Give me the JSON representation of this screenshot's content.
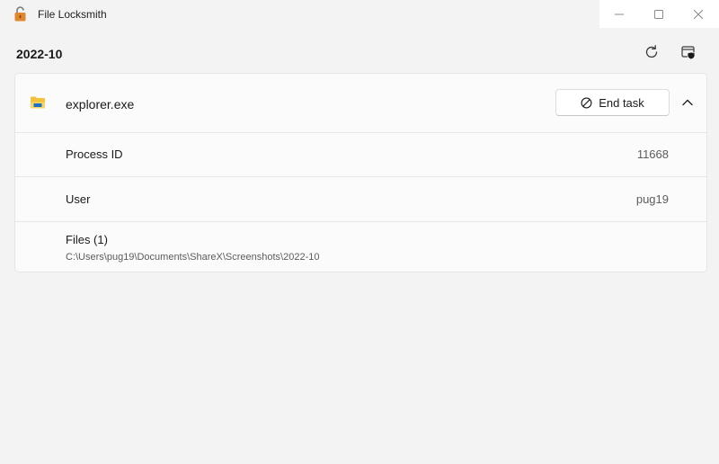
{
  "window": {
    "title": "File Locksmith",
    "controls": {
      "minimize": "minimize-icon",
      "maximize": "maximize-icon",
      "close": "close-icon"
    }
  },
  "header": {
    "title": "2022-10",
    "refresh_icon": "refresh-icon",
    "admin_icon": "restart-as-admin-icon"
  },
  "process": {
    "icon": "folder-icon",
    "name": "explorer.exe",
    "end_task_label": "End task",
    "end_task_icon": "block-icon",
    "expanded": true,
    "details": [
      {
        "label": "Process ID",
        "value": "11668"
      },
      {
        "label": "User",
        "value": "pug19"
      }
    ],
    "files_header": "Files (1)",
    "files": [
      "C:\\Users\\pug19\\Documents\\ShareX\\Screenshots\\2022-10"
    ]
  },
  "colors": {
    "background": "#f3f3f3",
    "card": "#fbfbfb",
    "folder_yellow": "#f3c13a",
    "folder_blue": "#1e6fc6",
    "lock_orange": "#e0862f"
  }
}
